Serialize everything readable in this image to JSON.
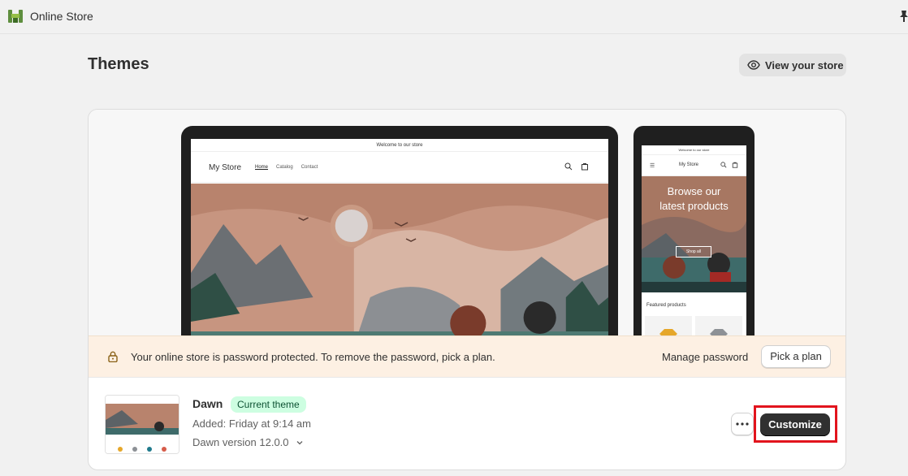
{
  "topbar": {
    "app_title": "Online Store",
    "logo_icon": "shopify-app-icon",
    "pin_icon": "pin-icon"
  },
  "header": {
    "title": "Themes",
    "view_store_label": "View your store"
  },
  "preview": {
    "desktop": {
      "announcement": "Welcome to our store",
      "store_name": "My Store",
      "nav": [
        "Home",
        "Catalog",
        "Contact"
      ]
    },
    "mobile": {
      "announcement": "Welcome to our store",
      "store_name": "My Store",
      "hero_line1": "Browse our",
      "hero_line2": "latest products",
      "shop_all": "Shop all",
      "featured": "Featured products"
    }
  },
  "banner": {
    "text": "Your online store is password protected. To remove the password, pick a plan.",
    "manage_label": "Manage password",
    "pick_plan_label": "Pick a plan"
  },
  "theme": {
    "name": "Dawn",
    "badge": "Current theme",
    "added": "Added: Friday at 9:14 am",
    "version": "Dawn version 12.0.0",
    "customize_label": "Customize"
  },
  "colors": {
    "highlight": "#e2141d",
    "badge_bg": "#cdfee1",
    "primary_btn": "#303030"
  }
}
